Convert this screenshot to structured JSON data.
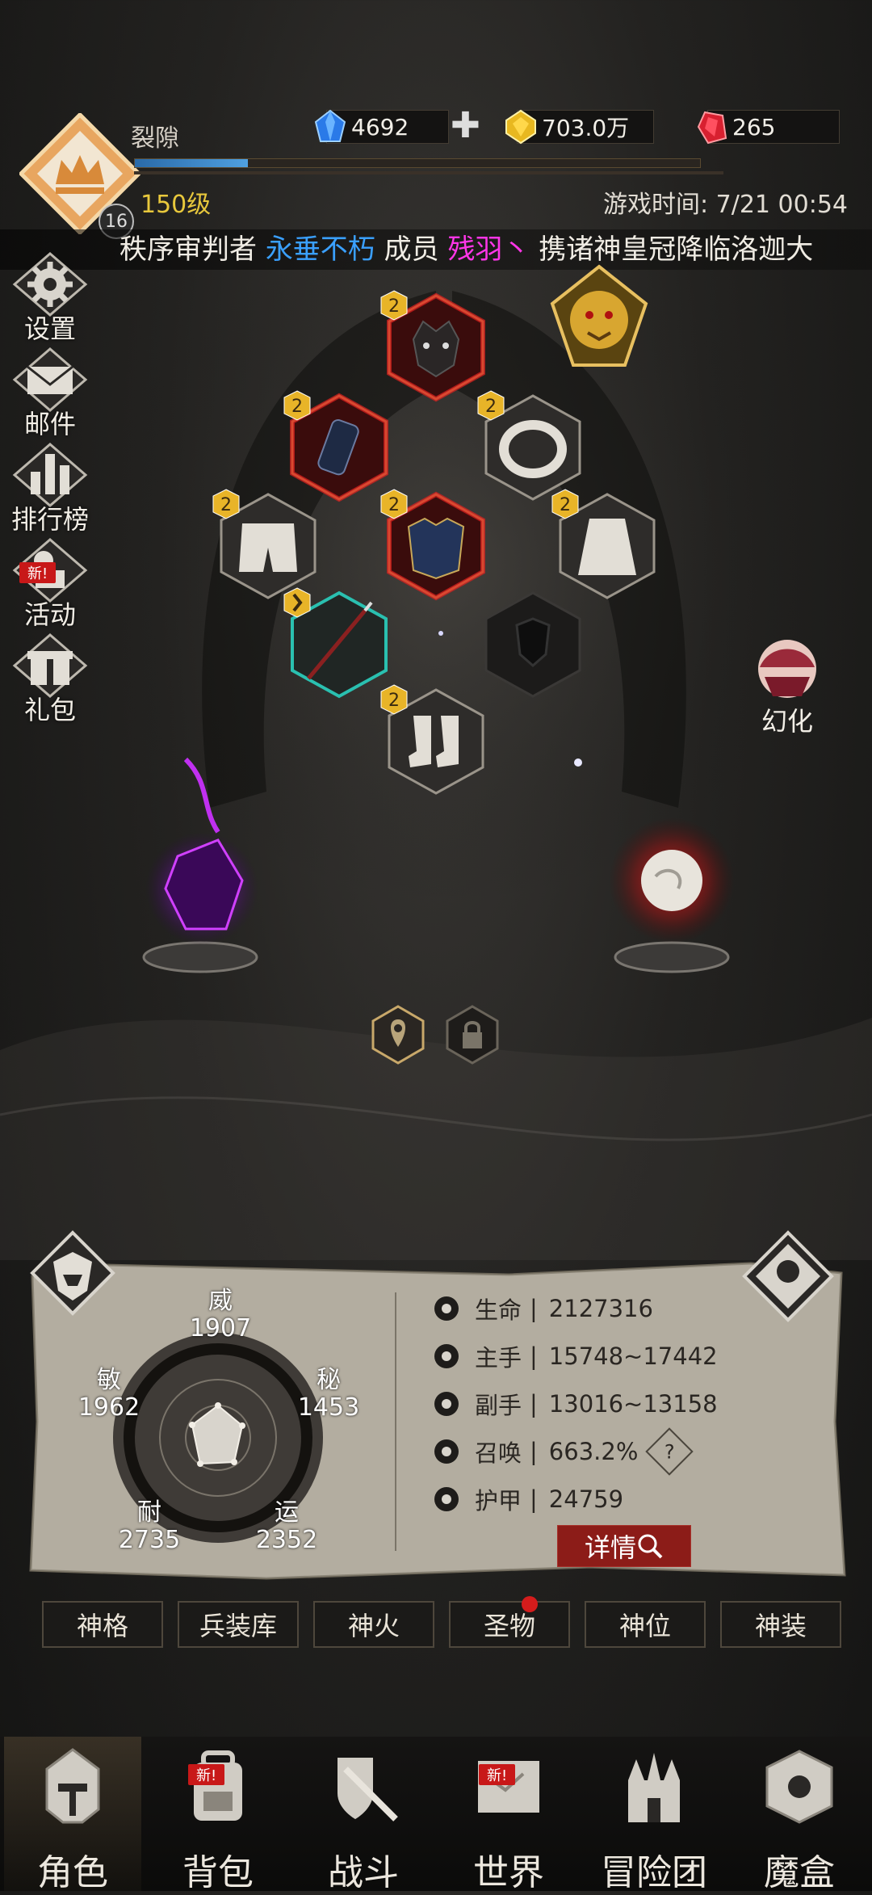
{
  "header": {
    "player_name": "裂隙",
    "level": "150级",
    "avatar_badge": "16",
    "exp_progress": 0.2,
    "game_time": "游戏时间: 7/21 00:54",
    "currencies": {
      "blue_gem": "4692",
      "gold_gem": "703.0万",
      "red_gem": "265"
    }
  },
  "ticker": {
    "part1": "秩序审判者",
    "guild": "永垂不朽",
    "part2": "成员",
    "member": "残羽丶",
    "part3": "携诸神皇冠降临洛迦大"
  },
  "side_menu": {
    "settings": "设置",
    "mail": "邮件",
    "ranking": "排行榜",
    "events": "活动",
    "events_new": "新!",
    "gift": "礼包"
  },
  "equipment": {
    "level_badge": "2",
    "transform_label": "幻化"
  },
  "attributes": {
    "wei": {
      "name": "威",
      "value": "1907"
    },
    "mi": {
      "name": "秘",
      "value": "1453"
    },
    "yun": {
      "name": "运",
      "value": "2352"
    },
    "nai": {
      "name": "耐",
      "value": "2735"
    },
    "min": {
      "name": "敏",
      "value": "1962"
    }
  },
  "stats": [
    {
      "name": "生命",
      "value": "2127316"
    },
    {
      "name": "主手",
      "value": "15748~17442"
    },
    {
      "name": "副手",
      "value": "13016~13158"
    },
    {
      "name": "召唤",
      "value": "663.2%"
    },
    {
      "name": "护甲",
      "value": "24759"
    }
  ],
  "stat_sep": "|",
  "help_mark": "?",
  "detail_button": "详情",
  "tabs": [
    "神格",
    "兵装库",
    "神火",
    "圣物",
    "神位",
    "神装"
  ],
  "nav": {
    "role": "角色",
    "bag": "背包",
    "battle": "战斗",
    "world": "世界",
    "team": "冒险团",
    "box": "魔盒",
    "new": "新!"
  },
  "colors": {
    "gold": "#e8c83c",
    "red_accent": "#c81818",
    "guild_blue": "#3aa0ff",
    "member_pink": "#ff36e8"
  }
}
